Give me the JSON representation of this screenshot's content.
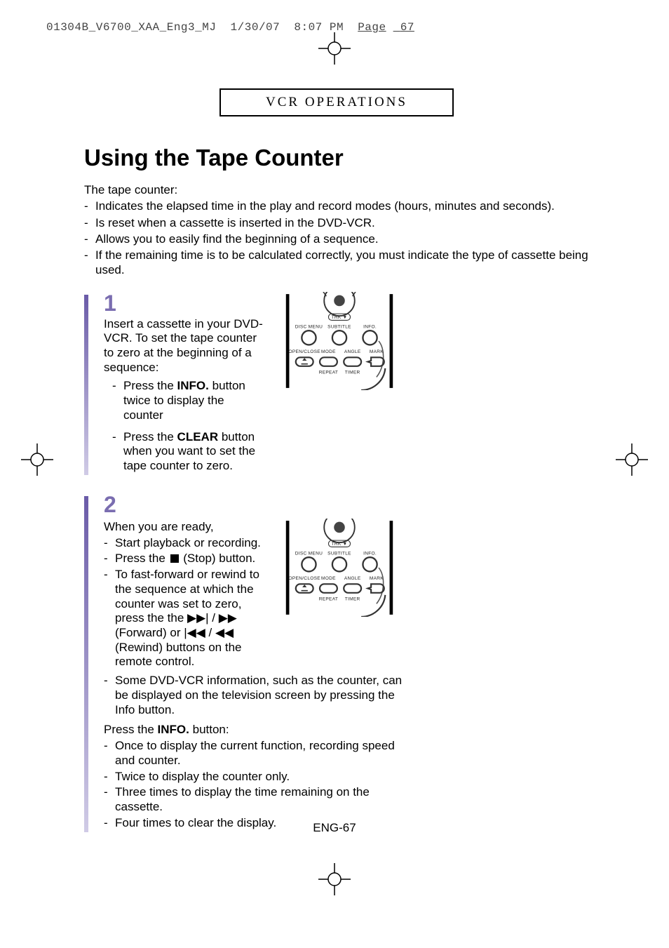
{
  "proof": {
    "file": "01304B_V6700_XAA_Eng3_MJ",
    "date": "1/30/07",
    "time": "8:07 PM",
    "page_label": "Page",
    "page_label_value": "67"
  },
  "section_label": "VCR OPERATIONS",
  "title": "Using the Tape Counter",
  "intro": {
    "lead": "The tape counter:",
    "items": [
      "Indicates the elapsed time in the play and record modes (hours, minutes and seconds).",
      "Is reset when a cassette is inserted in the DVD-VCR.",
      "Allows you to easily find the beginning of a sequence.",
      "If the remaining time is to be calculated correctly, you must indicate the type of cassette being used."
    ]
  },
  "steps": {
    "s1": {
      "num": "1",
      "lead": "Insert a cassette in your DVD-VCR. To set the tape counter to zero at the beginning of a sequence:",
      "items": [
        {
          "pre": "Press the ",
          "bold": "INFO.",
          "post": " button twice to display the counter"
        },
        {
          "pre": "Press the ",
          "bold": "CLEAR",
          "post": " button when you want to set the tape counter to zero."
        }
      ]
    },
    "s2": {
      "num": "2",
      "lead": "When you are ready,",
      "items_a": [
        {
          "text": "Start playback or recording."
        },
        {
          "pre": "Press the ",
          "glyph": "stop",
          "post": " (Stop) button."
        },
        {
          "text": "To fast-forward or rewind to the sequence at which the counter was set to zero, press the the ▶▶| / ▶▶ (Forward) or |◀◀ / ◀◀ (Rewind) buttons on the remote control."
        }
      ],
      "items_b": [
        {
          "text": "Some DVD-VCR information, such as the counter, can be displayed on the television screen by pressing the Info button."
        }
      ],
      "press_lead_pre": "Press the ",
      "press_lead_bold": "INFO.",
      "press_lead_post": " button:",
      "items_c": [
        "Once to display the current function, recording speed and counter.",
        "Twice to display the counter only.",
        "Three times to display the time remaining on the cassette.",
        "Four times to clear the display."
      ]
    }
  },
  "remote_labels": {
    "trk": "TRK ▼",
    "row1": [
      "DISC MENU",
      "SUBTITLE",
      "INFO."
    ],
    "row2": [
      "OPEN/CLOSE",
      "MODE",
      "ANGLE",
      "MARK"
    ],
    "row3": [
      "",
      "REPEAT",
      "TIMER",
      ""
    ]
  },
  "page_number": "ENG-67"
}
